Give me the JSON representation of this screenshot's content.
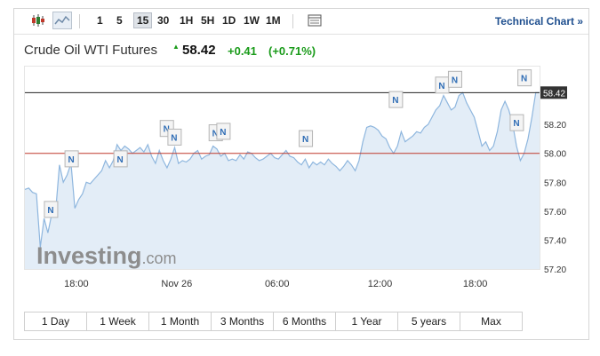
{
  "toolbar": {
    "chart_type_icons": [
      "candlestick-icon",
      "area-chart-icon"
    ],
    "intervals": [
      "1",
      "5",
      "15",
      "30",
      "1H",
      "5H",
      "1D",
      "1W",
      "1M"
    ],
    "active_interval": "15",
    "settings_icon": "table-icon",
    "technical_chart_label": "Technical Chart »"
  },
  "instrument": {
    "name": "Crude Oil WTI Futures",
    "price": "58.42",
    "change": "+0.41",
    "change_pct": "(+0.71%)",
    "direction_icon": "up-triangle-icon"
  },
  "watermark": {
    "brand": "Investing",
    "suffix": ".com"
  },
  "news_marker_label": "N",
  "period_buttons": [
    "1 Day",
    "1 Week",
    "1 Month",
    "3 Months",
    "6 Months",
    "1 Year",
    "5 years",
    "Max"
  ],
  "colors": {
    "line": "#8eb6de",
    "fill": "#e3edf7",
    "last_price_line": "#222222",
    "prev_close_line": "#c0392b",
    "positive": "#1a9b1a",
    "link": "#1f4f8f"
  },
  "chart_data": {
    "type": "area",
    "x_tick_labels": [
      "18:00",
      "Nov 26",
      "06:00",
      "12:00",
      "18:00"
    ],
    "y_tick_labels": [
      "57.20",
      "57.40",
      "57.60",
      "57.80",
      "58.00",
      "58.20"
    ],
    "ylim": [
      57.2,
      58.6
    ],
    "last_price": 58.42,
    "last_price_label": "58.42",
    "prev_close": 58.0,
    "grid": false,
    "series": [
      {
        "values": [
          57.75,
          57.76,
          57.73,
          57.72,
          57.35,
          57.55,
          57.45,
          57.58,
          57.6,
          57.92,
          57.8,
          57.85,
          57.93,
          57.62,
          57.68,
          57.72,
          57.8,
          57.79,
          57.82,
          57.85,
          57.88,
          57.95,
          57.9,
          57.95,
          58.06,
          58.02,
          58.05,
          58.03,
          58.0,
          58.02,
          58.04,
          58.01,
          58.06,
          57.98,
          57.93,
          58.02,
          57.95,
          57.9,
          57.96,
          58.04,
          57.93,
          57.95,
          57.94,
          57.96,
          58.0,
          58.02,
          57.96,
          57.98,
          57.99,
          58.05,
          58.03,
          57.98,
          58.0,
          57.95,
          57.96,
          57.95,
          57.99,
          57.96,
          58.01,
          58.0,
          57.97,
          57.95,
          57.96,
          57.98,
          58.0,
          57.97,
          57.96,
          57.99,
          58.02,
          57.98,
          57.97,
          57.94,
          57.92,
          57.96,
          57.9,
          57.94,
          57.92,
          57.94,
          57.92,
          57.96,
          57.93,
          57.91,
          57.88,
          57.91,
          57.95,
          57.92,
          57.88,
          57.95,
          58.08,
          58.18,
          58.19,
          58.18,
          58.16,
          58.12,
          58.1,
          58.04,
          58.0,
          58.05,
          58.15,
          58.08,
          58.1,
          58.12,
          58.15,
          58.14,
          58.18,
          58.2,
          58.25,
          58.3,
          58.33,
          58.4,
          58.35,
          58.3,
          58.32,
          58.4,
          58.42,
          58.35,
          58.3,
          58.25,
          58.15,
          58.05,
          58.08,
          58.02,
          58.05,
          58.15,
          58.3,
          58.36,
          58.3,
          58.2,
          58.05,
          57.95,
          58.0,
          58.1,
          58.25,
          58.42,
          58.42
        ]
      }
    ],
    "news_markers": [
      {
        "x": 0.05,
        "value": 57.52
      },
      {
        "x": 0.09,
        "value": 57.87
      },
      {
        "x": 0.185,
        "value": 57.87
      },
      {
        "x": 0.275,
        "value": 58.08
      },
      {
        "x": 0.29,
        "value": 58.02
      },
      {
        "x": 0.37,
        "value": 58.05
      },
      {
        "x": 0.385,
        "value": 58.06
      },
      {
        "x": 0.545,
        "value": 58.01
      },
      {
        "x": 0.72,
        "value": 58.28
      },
      {
        "x": 0.81,
        "value": 58.38
      },
      {
        "x": 0.835,
        "value": 58.42
      },
      {
        "x": 0.955,
        "value": 58.12
      },
      {
        "x": 0.97,
        "value": 58.43
      }
    ]
  }
}
